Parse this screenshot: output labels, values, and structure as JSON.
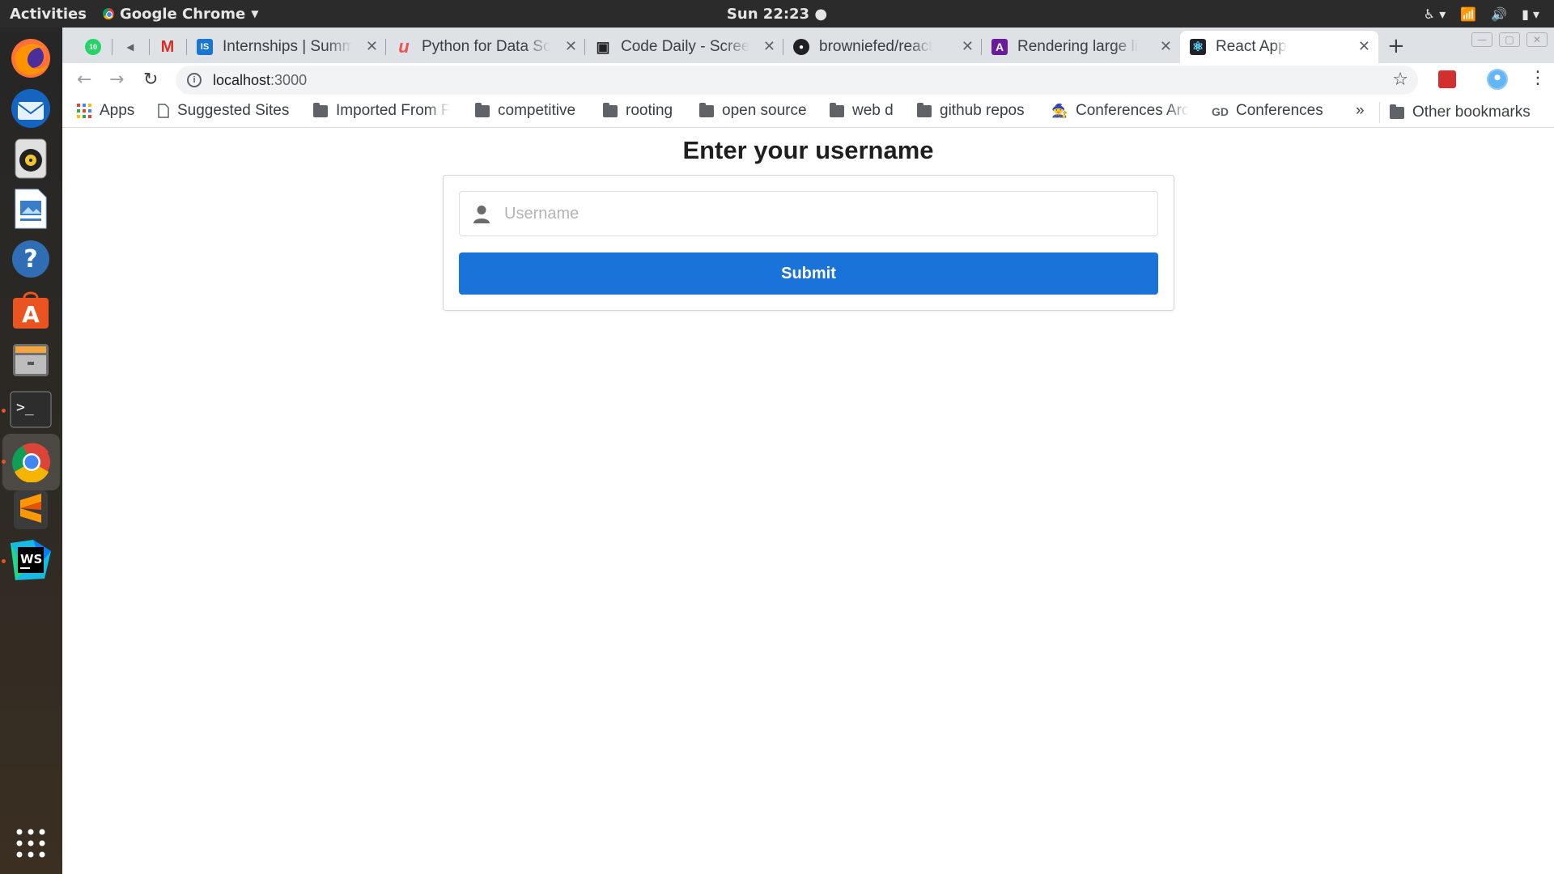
{
  "topbar": {
    "activities": "Activities",
    "app_name": "Google Chrome",
    "clock": "Sun 22:23"
  },
  "dock": {
    "items": [
      {
        "name": "firefox-icon"
      },
      {
        "name": "thunderbird-icon"
      },
      {
        "name": "rhythmbox-icon"
      },
      {
        "name": "libreoffice-writer-icon"
      },
      {
        "name": "help-icon"
      },
      {
        "name": "ubuntu-software-icon"
      },
      {
        "name": "files-icon"
      },
      {
        "name": "terminal-icon"
      },
      {
        "name": "chrome-icon"
      },
      {
        "name": "sublime-text-icon"
      },
      {
        "name": "webstorm-icon"
      },
      {
        "name": "show-applications-icon"
      }
    ],
    "webstorm_label": "WS"
  },
  "tabs": [
    {
      "title": "",
      "icon": "whatsapp-icon",
      "badge": "10",
      "color": "#25d366"
    },
    {
      "title": "",
      "icon": "muted-speaker-icon",
      "color": "#5f6368"
    },
    {
      "title": "",
      "icon": "gmail-icon",
      "glyph": "M",
      "color": "#d93025"
    },
    {
      "title": "Internships | Summ",
      "icon": "internshala-icon",
      "glyph": "IS",
      "color": "#1976d2"
    },
    {
      "title": "Python for Data Sc",
      "icon": "udemy-icon",
      "glyph": "u",
      "color": "#ec5252"
    },
    {
      "title": "Code Daily - Scree",
      "icon": "code-daily-icon",
      "glyph": "▣",
      "color": "#202124"
    },
    {
      "title": "browniefed/react",
      "icon": "github-icon",
      "glyph": "●",
      "color": "#202124"
    },
    {
      "title": "Rendering large li",
      "icon": "angular-icon",
      "glyph": "A",
      "color": "#6a1b9a"
    },
    {
      "title": "React App",
      "icon": "react-icon",
      "glyph": "⚛",
      "color": "#61dafb"
    }
  ],
  "toolbar": {
    "url_host": "localhost",
    "url_port": ":3000"
  },
  "bookmarks": {
    "apps": "Apps",
    "items": [
      "Suggested Sites",
      "Imported From F",
      "competitive",
      "rooting",
      "open source",
      "web d",
      "github repos",
      "Conferences Arc",
      "Conferences"
    ],
    "overflow": "»",
    "other": "Other bookmarks"
  },
  "page": {
    "title": "Enter your username",
    "input_placeholder": "Username",
    "input_value": "",
    "submit_label": "Submit"
  },
  "colors": {
    "submit_button": "#1a73d9",
    "ubuntu_accent": "#e95420"
  }
}
